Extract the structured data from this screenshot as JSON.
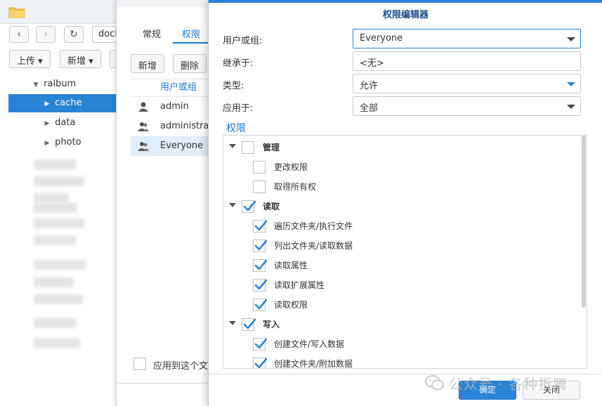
{
  "file_station": {
    "path_value": "dock",
    "toolbar": {
      "upload_label": "上传 ▾",
      "create_label": "新增 ▾"
    },
    "tree": [
      {
        "label": "ralbum",
        "arrow": "▼",
        "selected": false
      },
      {
        "label": "cache",
        "arrow": "▶",
        "selected": true
      },
      {
        "label": "data",
        "arrow": "▶",
        "selected": false
      },
      {
        "label": "photo",
        "arrow": "▶",
        "selected": false
      }
    ],
    "nav": {
      "back": "‹",
      "forward": "›",
      "refresh": "↻"
    }
  },
  "properties": {
    "tabs": [
      {
        "label": "常规"
      },
      {
        "label": "权限"
      }
    ],
    "add_label": "新增",
    "delete_label": "删除",
    "column_header": "用户或组",
    "rows": [
      {
        "label": "admin"
      },
      {
        "label": "administrat"
      },
      {
        "label": "Everyone"
      }
    ],
    "apply_sub_label": "应用到这个文件"
  },
  "editor": {
    "title": "权限编辑器",
    "fields": {
      "user_label": "用户或组:",
      "user_value": "Everyone",
      "inherit_label": "继承于:",
      "inherit_value": "<无>",
      "type_label": "类型:",
      "type_value": "允许",
      "apply_label": "应用于:",
      "apply_value": "全部"
    },
    "perm_section_title": "权限",
    "perm_groups": [
      {
        "label": "管理",
        "checked": false,
        "children": [
          {
            "label": "更改权限",
            "checked": false
          },
          {
            "label": "取得所有权",
            "checked": false
          }
        ]
      },
      {
        "label": "读取",
        "checked": true,
        "children": [
          {
            "label": "遍历文件夹/执行文件",
            "checked": true
          },
          {
            "label": "列出文件夹/读取数据",
            "checked": true
          },
          {
            "label": "读取属性",
            "checked": true
          },
          {
            "label": "读取扩展属性",
            "checked": true
          },
          {
            "label": "读取权限",
            "checked": true
          }
        ]
      },
      {
        "label": "写入",
        "checked": true,
        "children": [
          {
            "label": "创建文件/写入数据",
            "checked": true
          },
          {
            "label": "创建文件夹/附加数据",
            "checked": true
          }
        ]
      }
    ],
    "ok_label": "确定",
    "close_label": "关闭",
    "colors": {
      "accent": "#2a84d6",
      "title": "#1b4f8a"
    }
  },
  "watermark": {
    "text": "公众号 · 各种折腾"
  }
}
